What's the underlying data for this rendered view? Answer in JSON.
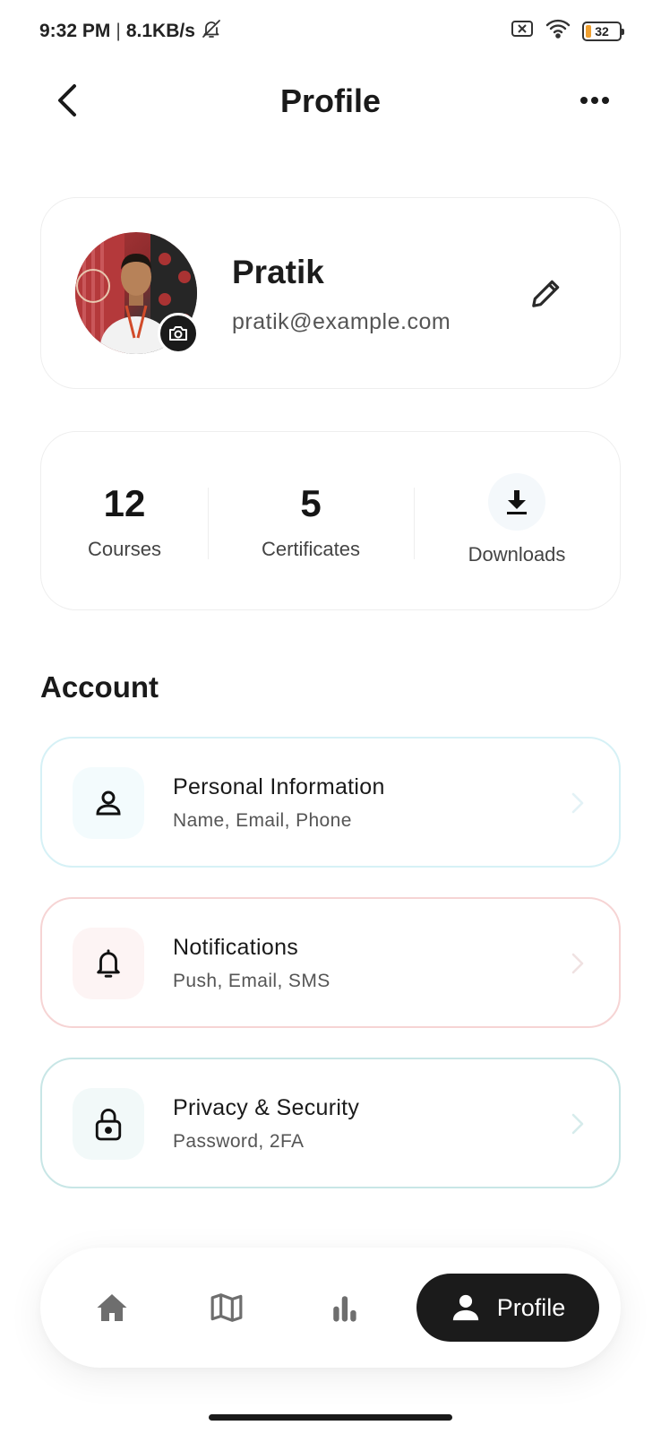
{
  "status_bar": {
    "time": "9:32 PM",
    "separator": "|",
    "network_speed": "8.1KB/s",
    "battery_level": "32",
    "icons": [
      "bell-off-icon",
      "sim-x-icon",
      "wifi-icon",
      "battery-icon"
    ]
  },
  "header": {
    "title": "Profile",
    "back_icon": "chevron-left-icon",
    "more_icon": "more-horizontal-icon"
  },
  "profile": {
    "name": "Pratik",
    "email": "pratik@example.com",
    "camera_icon": "camera-icon",
    "edit_icon": "pencil-icon"
  },
  "stats": {
    "courses": {
      "value": "12",
      "label": "Courses"
    },
    "certificates": {
      "value": "5",
      "label": "Certificates"
    },
    "downloads": {
      "label": "Downloads",
      "icon": "download-icon"
    }
  },
  "account": {
    "section_title": "Account",
    "items": [
      {
        "title": "Personal Information",
        "subtitle": "Name, Email, Phone",
        "icon": "user-icon",
        "accent": "#d6f1f6"
      },
      {
        "title": "Notifications",
        "subtitle": "Push, Email, SMS",
        "icon": "bell-icon",
        "accent": "#f6d4d4"
      },
      {
        "title": "Privacy & Security",
        "subtitle": "Password, 2FA",
        "icon": "lock-icon",
        "accent": "#c8e6e6"
      }
    ]
  },
  "bottom_nav": {
    "items": [
      {
        "icon": "home-icon"
      },
      {
        "icon": "map-icon"
      },
      {
        "icon": "bar-chart-icon"
      },
      {
        "icon": "user-icon",
        "label": "Profile",
        "active": true
      }
    ]
  }
}
